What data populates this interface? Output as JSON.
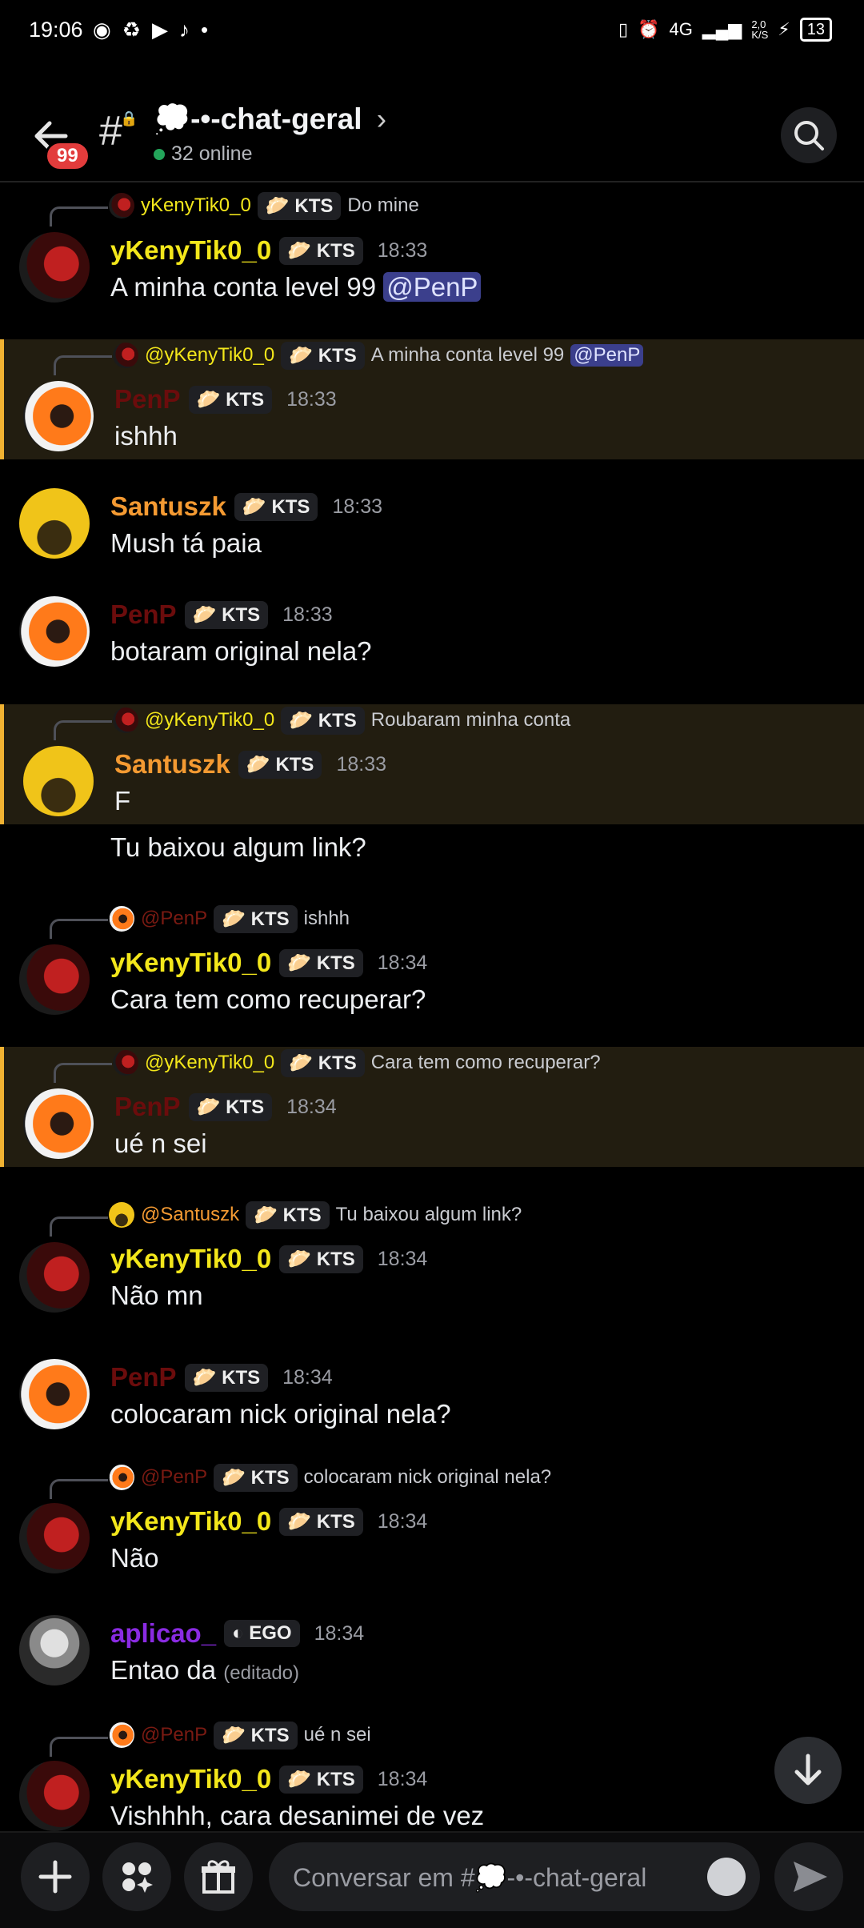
{
  "status": {
    "time": "19:06",
    "network": "4G",
    "speed_top": "2,0",
    "speed_bottom": "K/S",
    "battery": "13"
  },
  "header": {
    "badge": "99",
    "hash": "#",
    "title": "💭-•-chat-geral",
    "online": "32 online"
  },
  "messages": [
    {
      "reply": {
        "user": "yKenyTik0_0",
        "tag": "KTS",
        "text": "Do mine"
      },
      "user": "yKenyTik0_0",
      "tag": "KTS",
      "time": "18:33",
      "text": "A minha conta level 99",
      "mention": "@PenP"
    },
    {
      "reply": {
        "user": "@yKenyTik0_0",
        "tag": "KTS",
        "text": "A minha conta level 99",
        "mention": "@PenP"
      },
      "user": "PenP",
      "tag": "KTS",
      "time": "18:33",
      "text": "ishhh"
    },
    {
      "user": "Santuszk",
      "tag": "KTS",
      "time": "18:33",
      "text": "Mush tá paia"
    },
    {
      "user": "PenP",
      "tag": "KTS",
      "time": "18:33",
      "text": "botaram original nela?"
    },
    {
      "reply": {
        "user": "@yKenyTik0_0",
        "tag": "KTS",
        "text": "Roubaram minha conta"
      },
      "user": "Santuszk",
      "tag": "KTS",
      "time": "18:33",
      "text": "F",
      "text2": "Tu baixou algum link?"
    },
    {
      "reply": {
        "user": "@PenP",
        "tag": "KTS",
        "text": "ishhh"
      },
      "user": "yKenyTik0_0",
      "tag": "KTS",
      "time": "18:34",
      "text": "Cara tem como recuperar?"
    },
    {
      "reply": {
        "user": "@yKenyTik0_0",
        "tag": "KTS",
        "text": "Cara tem como recuperar?"
      },
      "user": "PenP",
      "tag": "KTS",
      "time": "18:34",
      "text": "ué n sei"
    },
    {
      "reply": {
        "user": "@Santuszk",
        "tag": "KTS",
        "text": "Tu baixou algum link?"
      },
      "user": "yKenyTik0_0",
      "tag": "KTS",
      "time": "18:34",
      "text": "Não mn"
    },
    {
      "user": "PenP",
      "tag": "KTS",
      "time": "18:34",
      "text": "colocaram nick original nela?"
    },
    {
      "reply": {
        "user": "@PenP",
        "tag": "KTS",
        "text": "colocaram nick original nela?"
      },
      "user": "yKenyTik0_0",
      "tag": "KTS",
      "time": "18:34",
      "text": "Não"
    },
    {
      "user": "aplicao_",
      "tag": "EGO",
      "time": "18:34",
      "text": "Entao da",
      "edited": "(editado)"
    },
    {
      "reply": {
        "user": "@PenP",
        "tag": "KTS",
        "text": "ué n sei"
      },
      "user": "yKenyTik0_0",
      "tag": "KTS",
      "time": "18:34",
      "text": "Vishhhh, cara desanimei de vez"
    }
  ],
  "composer": {
    "placeholder": "Conversar em #💭-•-chat-geral"
  },
  "icons": [
    "back-arrow-icon",
    "search-icon",
    "arrow-down-icon",
    "plus-icon",
    "apps-icon",
    "gift-icon",
    "emoji-icon",
    "send-icon"
  ],
  "colors": {
    "ykeny": "#f3e71b",
    "penp": "#6b0c0c",
    "santuszk": "#f49a32",
    "aplicao": "#8a2be2",
    "highlight": "#f0b232"
  }
}
